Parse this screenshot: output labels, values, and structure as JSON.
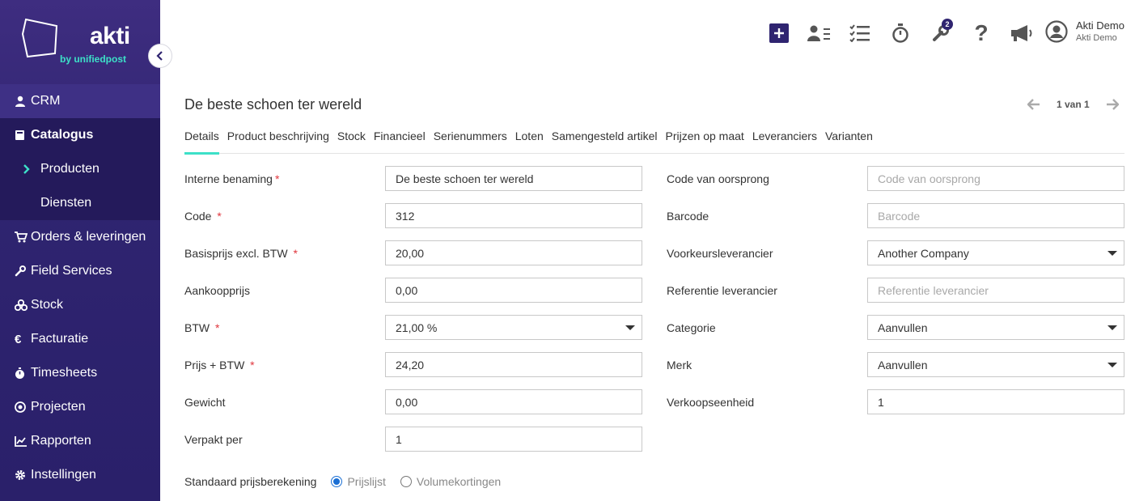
{
  "brand": {
    "name": "akti",
    "sub": "by unifiedpost"
  },
  "sidebar": {
    "items": [
      {
        "label": "CRM",
        "icon": "user-icon"
      },
      {
        "label": "Catalogus",
        "icon": "book-icon"
      },
      {
        "label": "Producten",
        "icon": "chevron-right-icon"
      },
      {
        "label": "Diensten"
      },
      {
        "label": "Orders & leveringen",
        "icon": "cart-icon"
      },
      {
        "label": "Field Services",
        "icon": "wrench-icon"
      },
      {
        "label": "Stock",
        "icon": "cubes-icon"
      },
      {
        "label": "Facturatie",
        "icon": "euro-icon"
      },
      {
        "label": "Timesheets",
        "icon": "stopwatch-icon"
      },
      {
        "label": "Projecten",
        "icon": "target-icon"
      },
      {
        "label": "Rapporten",
        "icon": "chart-icon"
      },
      {
        "label": "Instellingen",
        "icon": "gear-icon"
      }
    ]
  },
  "topbar": {
    "badge_count": "2",
    "user": {
      "name": "Akti Demo",
      "company": "Akti Demo"
    }
  },
  "page": {
    "title": "De beste schoen ter wereld",
    "pager": "1 van 1"
  },
  "tabs": [
    "Details",
    "Product beschrijving",
    "Stock",
    "Financieel",
    "Serienummers",
    "Loten",
    "Samengesteld artikel",
    "Prijzen op maat",
    "Leveranciers",
    "Varianten"
  ],
  "form": {
    "left": [
      {
        "label": "Interne benaming",
        "value": "De beste schoen ter wereld"
      },
      {
        "label": "Code",
        "value": "312"
      },
      {
        "label": "Basisprijs excl. BTW",
        "value": "20,00"
      },
      {
        "label": "Aankoopprijs",
        "value": "0,00"
      },
      {
        "label": "BTW",
        "value": "21,00 %"
      },
      {
        "label": "Prijs + BTW",
        "value": "24,20"
      },
      {
        "label": "Gewicht",
        "value": "0,00"
      },
      {
        "label": "Verpakt per",
        "value": "1"
      }
    ],
    "right": [
      {
        "label": "Code van oorsprong",
        "placeholder": "Code van oorsprong"
      },
      {
        "label": "Barcode",
        "placeholder": "Barcode"
      },
      {
        "label": "Voorkeursleverancier",
        "value": "Another Company"
      },
      {
        "label": "Referentie leverancier",
        "placeholder": "Referentie leverancier"
      },
      {
        "label": "Categorie",
        "value": "Aanvullen"
      },
      {
        "label": "Merk",
        "value": "Aanvullen"
      },
      {
        "label": "Verkoopseenheid",
        "value": "1"
      }
    ],
    "required_mark": "*",
    "pricing": {
      "label": "Standaard prijsberekening",
      "option1": "Prijslijst",
      "option2": "Volumekortingen"
    }
  },
  "colors": {
    "sidebar": "#2f2470",
    "accent": "#3de0c8",
    "required": "#e0363d"
  }
}
